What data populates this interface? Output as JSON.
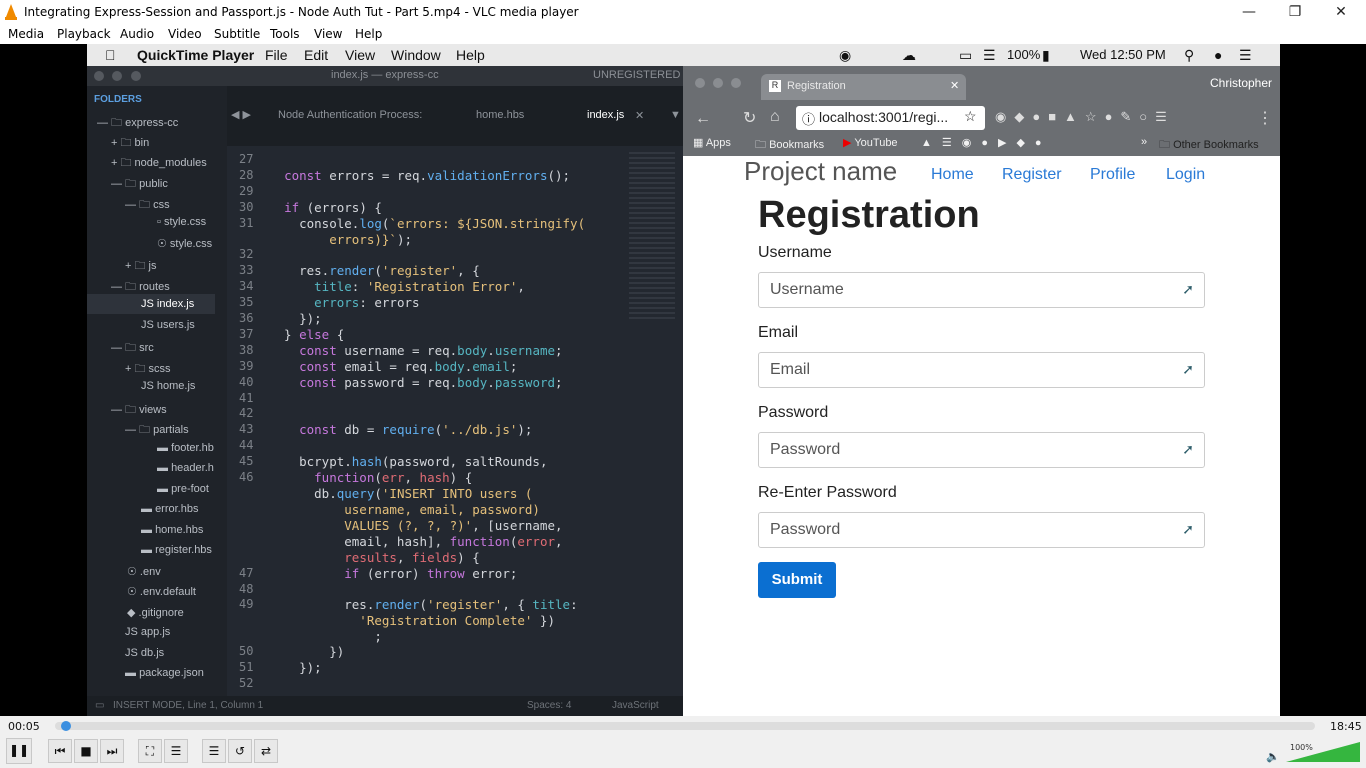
{
  "vlc": {
    "title": "Integrating Express-Session and Passport.js - Node Auth Tut - Part 5.mp4 - VLC media player",
    "menu": [
      "Media",
      "Playback",
      "Audio",
      "Video",
      "Subtitle",
      "Tools",
      "View",
      "Help"
    ],
    "time_elapsed": "00:05",
    "time_total": "18:45",
    "volume": "100%",
    "progress": 0.005
  },
  "mac": {
    "app": "QuickTime Player",
    "menu": [
      "File",
      "Edit",
      "View",
      "Window",
      "Help"
    ],
    "battery": "100%",
    "clock": "Wed 12:50 PM"
  },
  "editor": {
    "window_title": "index.js — express-cc",
    "unregistered": "UNREGISTERED",
    "folders_label": "FOLDERS",
    "tree": [
      "express-cc",
      "bin",
      "node_modules",
      "public",
      "css",
      "style.css",
      "style.css",
      "js",
      "routes",
      "index.js",
      "users.js",
      "src",
      "scss",
      "home.js",
      "views",
      "partials",
      "footer.hb",
      "header.h",
      "pre-foot",
      "error.hbs",
      "home.hbs",
      "register.hbs",
      ".env",
      ".env.default",
      ".gitignore",
      "app.js",
      "db.js",
      "package.json"
    ],
    "tabs": [
      "Node Authentication Process:",
      "home.hbs",
      "index.js"
    ],
    "status": {
      "mode": "INSERT MODE, Line 1, Column 1",
      "spaces": "Spaces: 4",
      "lang": "JavaScript"
    },
    "line_numbers": [
      "27",
      "28",
      "29",
      "30",
      "31",
      "",
      "32",
      "33",
      "34",
      "35",
      "36",
      "37",
      "38",
      "39",
      "40",
      "41",
      "42",
      "43",
      "44",
      "45",
      "46",
      "",
      "",
      "",
      "",
      "",
      "47",
      "48",
      "49",
      "",
      "",
      "50",
      "51",
      "52"
    ]
  },
  "browser": {
    "tab_title": "Registration",
    "profile": "Christopher",
    "url": "localhost:3001/regi...",
    "bookmarks": [
      "Apps",
      "Bookmarks",
      "YouTube",
      "Other Bookmarks"
    ],
    "brand": "Project name",
    "nav": [
      "Home",
      "Register",
      "Profile",
      "Login"
    ],
    "heading": "Registration",
    "fields": [
      {
        "label": "Username",
        "placeholder": "Username"
      },
      {
        "label": "Email",
        "placeholder": "Email"
      },
      {
        "label": "Password",
        "placeholder": "Password"
      },
      {
        "label": "Re-Enter Password",
        "placeholder": "Password"
      }
    ],
    "submit": "Submit"
  }
}
